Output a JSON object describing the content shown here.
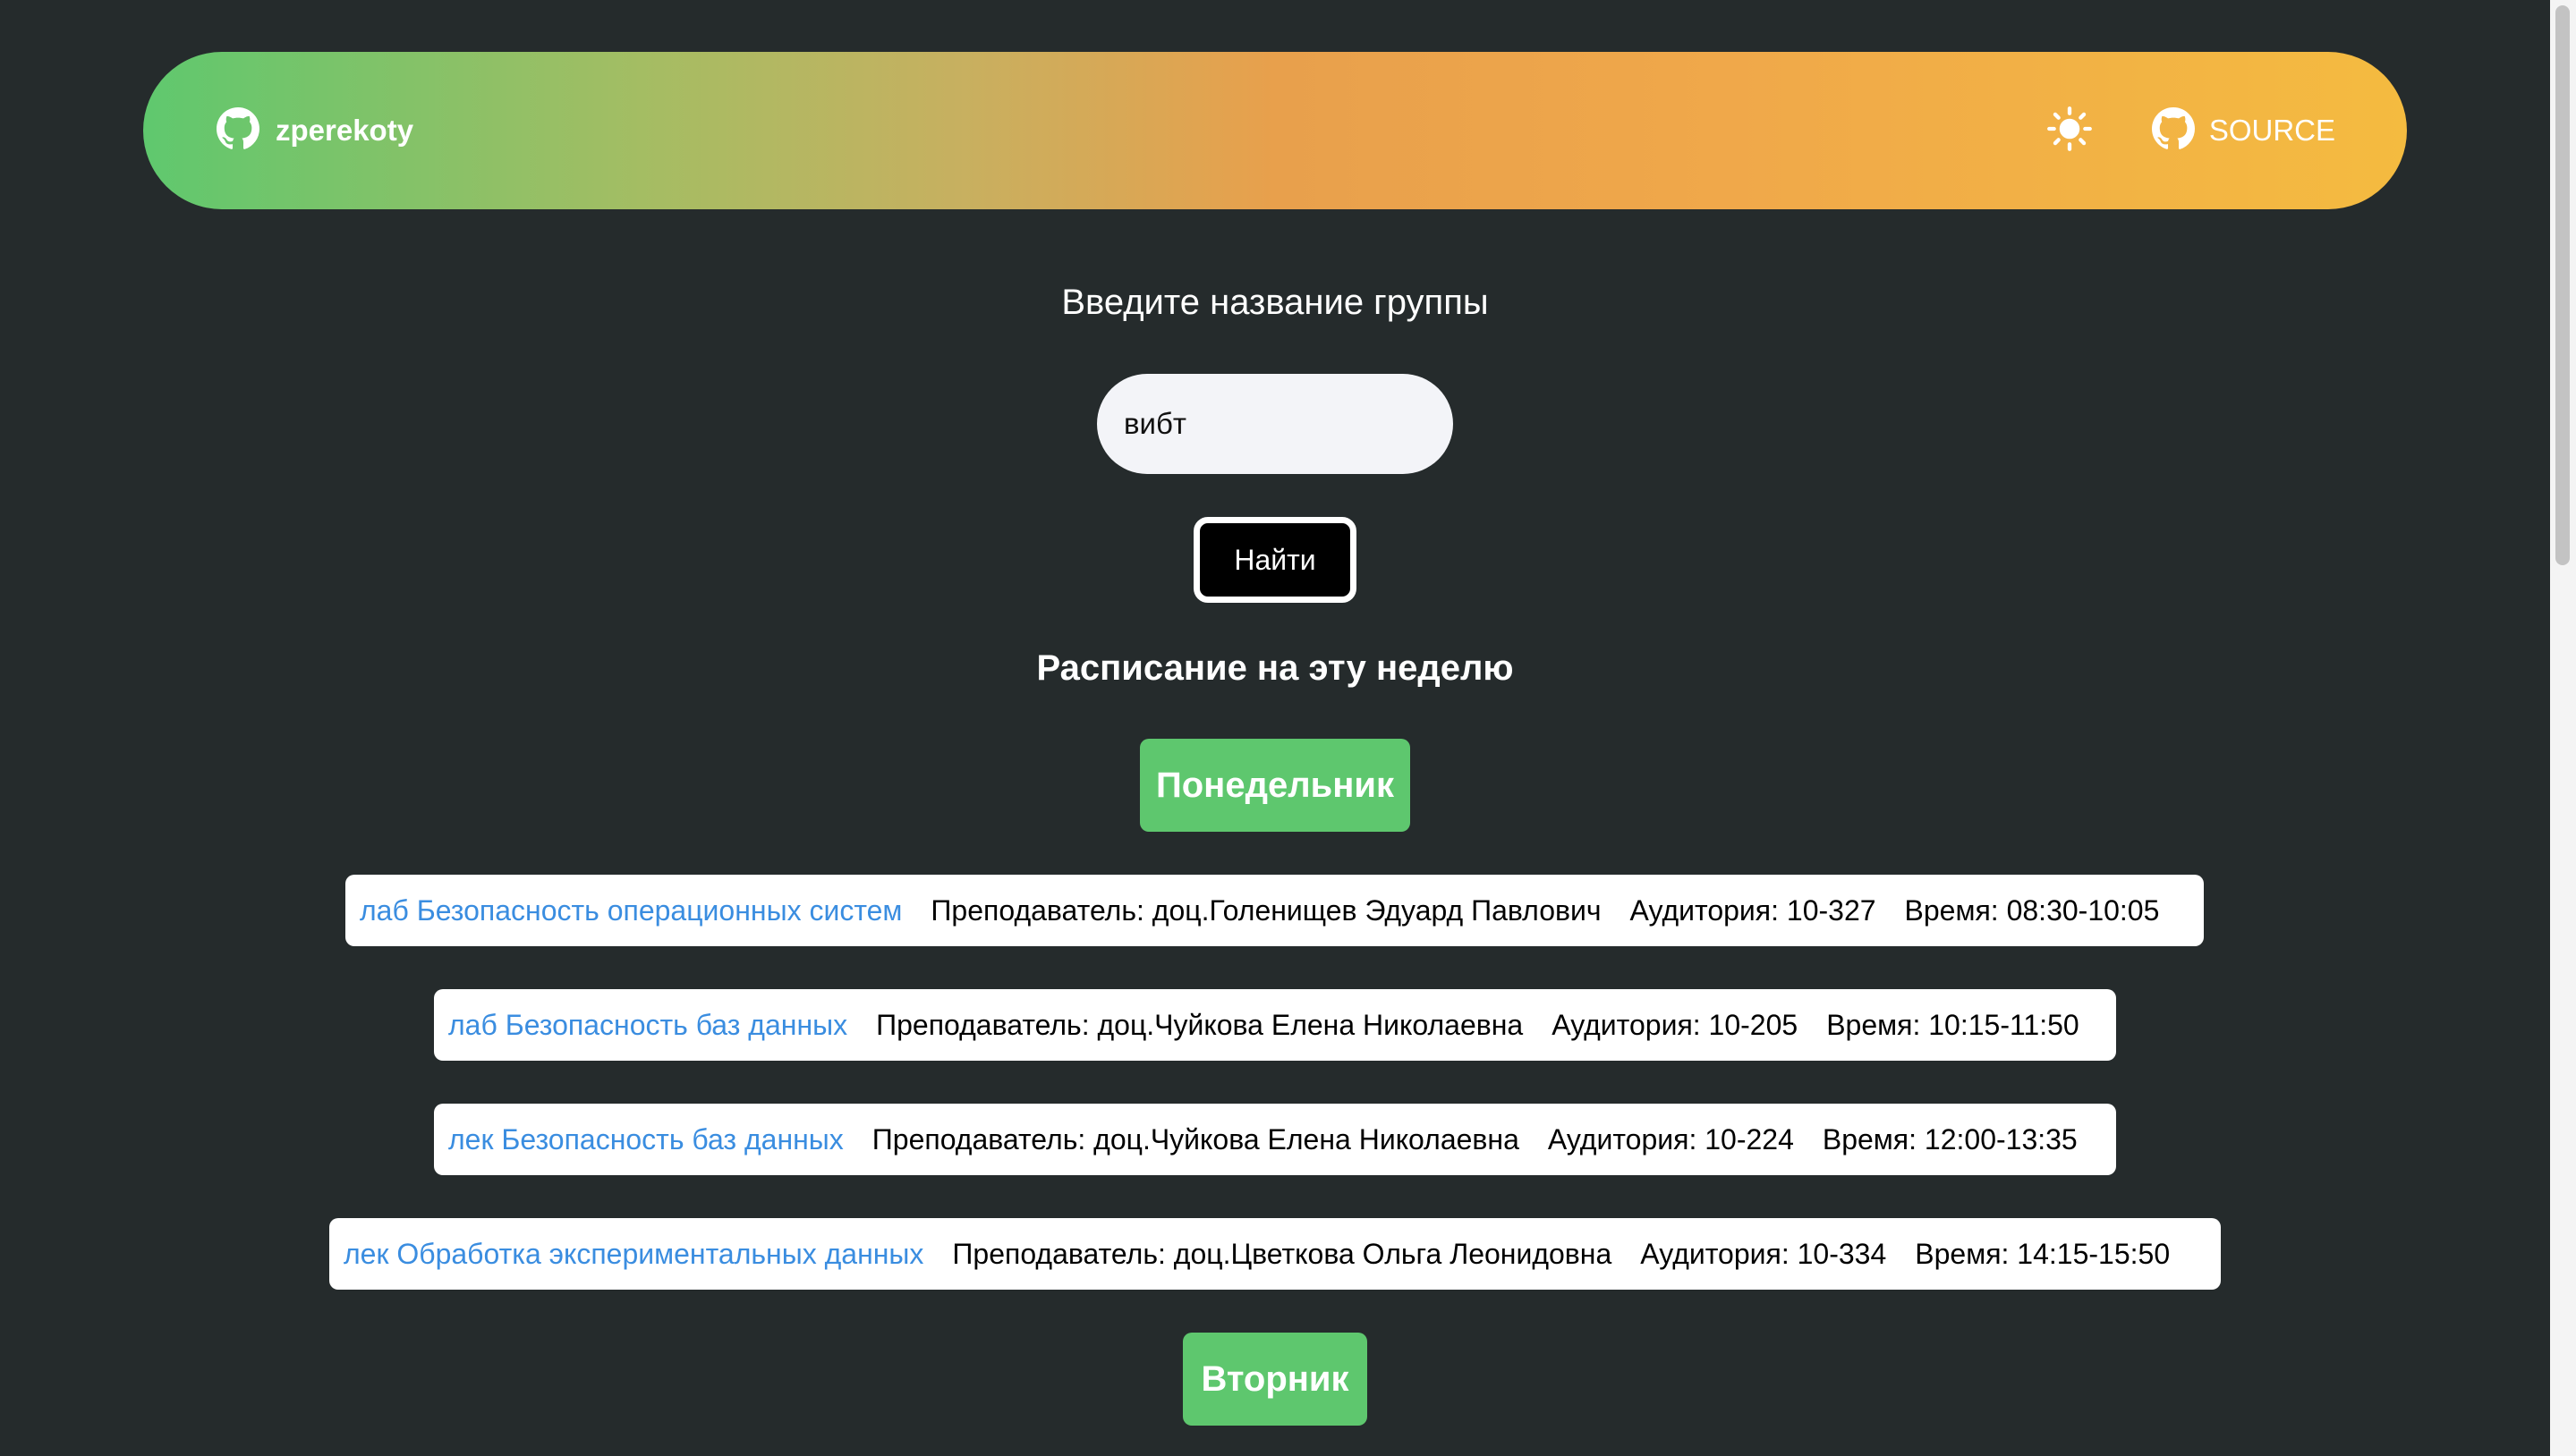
{
  "header": {
    "brand_label": "zperekoty",
    "source_label": "SOURCE",
    "brand_icon": "github-icon",
    "theme_icon": "sun-icon"
  },
  "search": {
    "title": "Введите название группы",
    "value": "вибт",
    "button_label": "Найти"
  },
  "schedule": {
    "heading": "Расписание на эту неделю",
    "days": [
      {
        "label": "Понедельник",
        "lessons": [
          {
            "title": "лаб Безопасность операционных систем",
            "teacher": "Преподаватель: доц.Голенищев Эдуард Павлович",
            "room": "Аудитория: 10-327",
            "time": "Время: 08:30-10:05"
          },
          {
            "title": "лаб Безопасность баз данных",
            "teacher": "Преподаватель: доц.Чуйкова Елена Николаевна",
            "room": "Аудитория: 10-205",
            "time": "Время: 10:15-11:50"
          },
          {
            "title": "лек Безопасность баз данных",
            "teacher": "Преподаватель: доц.Чуйкова Елена Николаевна",
            "room": "Аудитория: 10-224",
            "time": "Время: 12:00-13:35"
          },
          {
            "title": "лек Обработка экспериментальных данных",
            "teacher": "Преподаватель: доц.Цветкова Ольга Леонидовна",
            "room": "Аудитория: 10-334",
            "time": "Время: 14:15-15:50"
          }
        ]
      },
      {
        "label": "Вторник",
        "lessons": []
      }
    ]
  },
  "colors": {
    "background": "#252b2c",
    "accent_green": "#5ec76e",
    "link_blue": "#3a8de0",
    "gradient_start": "#5fc86e",
    "gradient_end": "#f4bb40"
  }
}
